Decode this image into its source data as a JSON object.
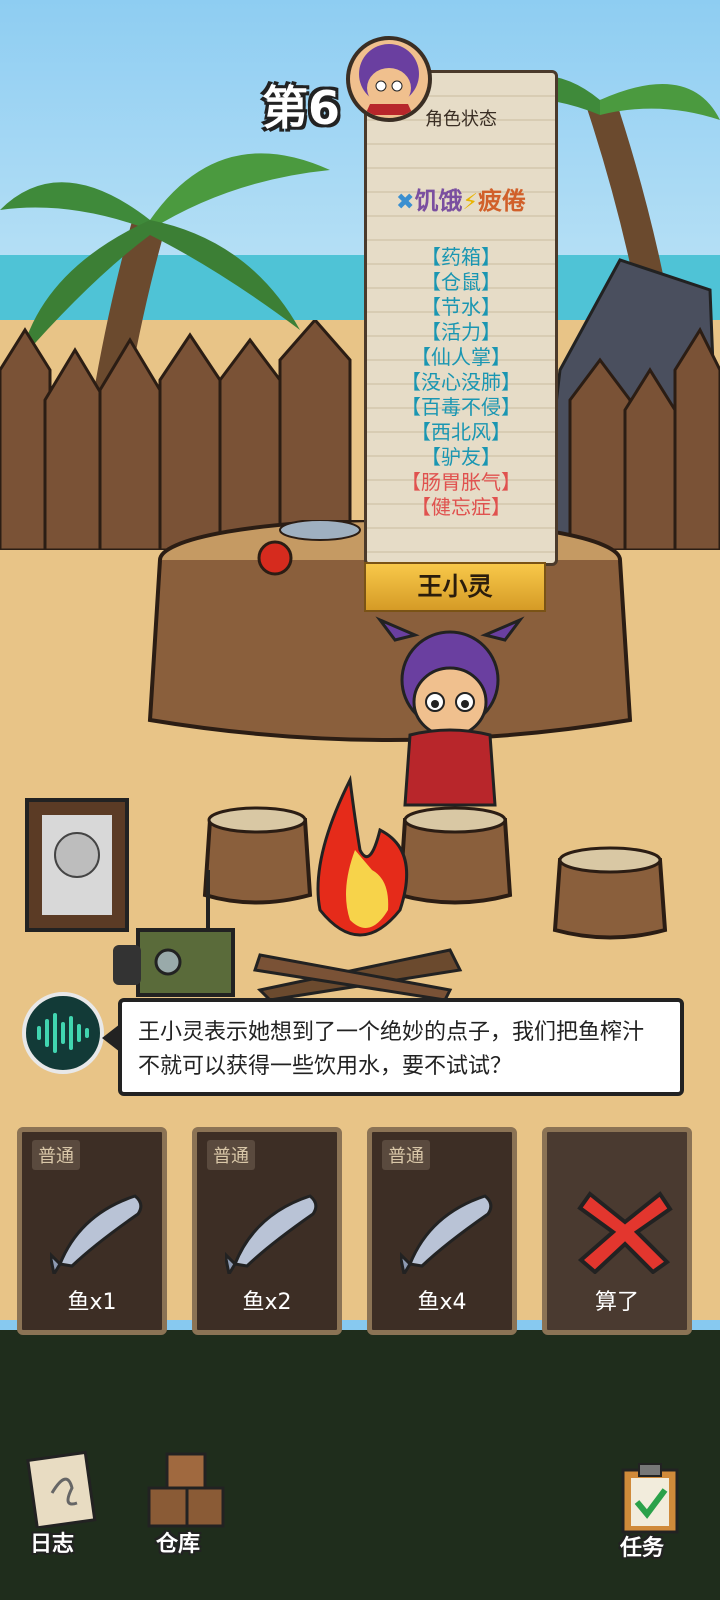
{
  "hud": {
    "day_counter": "第6"
  },
  "status_panel": {
    "title": "角色状态",
    "conditions": {
      "hunger": "饥饿",
      "fatigue": "疲倦"
    },
    "traits": [
      {
        "label": "【药箱】",
        "bad": false
      },
      {
        "label": "【仓鼠】",
        "bad": false
      },
      {
        "label": "【节水】",
        "bad": false
      },
      {
        "label": "【活力】",
        "bad": false
      },
      {
        "label": "【仙人掌】",
        "bad": false
      },
      {
        "label": "【没心没肺】",
        "bad": false
      },
      {
        "label": "【百毒不侵】",
        "bad": false
      },
      {
        "label": "【西北风】",
        "bad": false
      },
      {
        "label": "【驴友】",
        "bad": false
      },
      {
        "label": "【肠胃胀气】",
        "bad": true
      },
      {
        "label": "【健忘症】",
        "bad": true
      }
    ],
    "character_name": "王小灵"
  },
  "dialog": {
    "text": "王小灵表示她想到了一个绝妙的点子，我们把鱼榨汁不就可以获得一些饮用水，要不试试？"
  },
  "choices": [
    {
      "tag": "普通",
      "label": "鱼x1"
    },
    {
      "tag": "普通",
      "label": "鱼x2"
    },
    {
      "tag": "普通",
      "label": "鱼x4"
    },
    {
      "label": "算了"
    }
  ],
  "nav": {
    "log": "日志",
    "storage": "仓库",
    "tasks": "任务"
  },
  "colors": {
    "trait_good": "#1a96b2",
    "trait_bad": "#e0524f",
    "name_plate": "#f8c84a"
  }
}
